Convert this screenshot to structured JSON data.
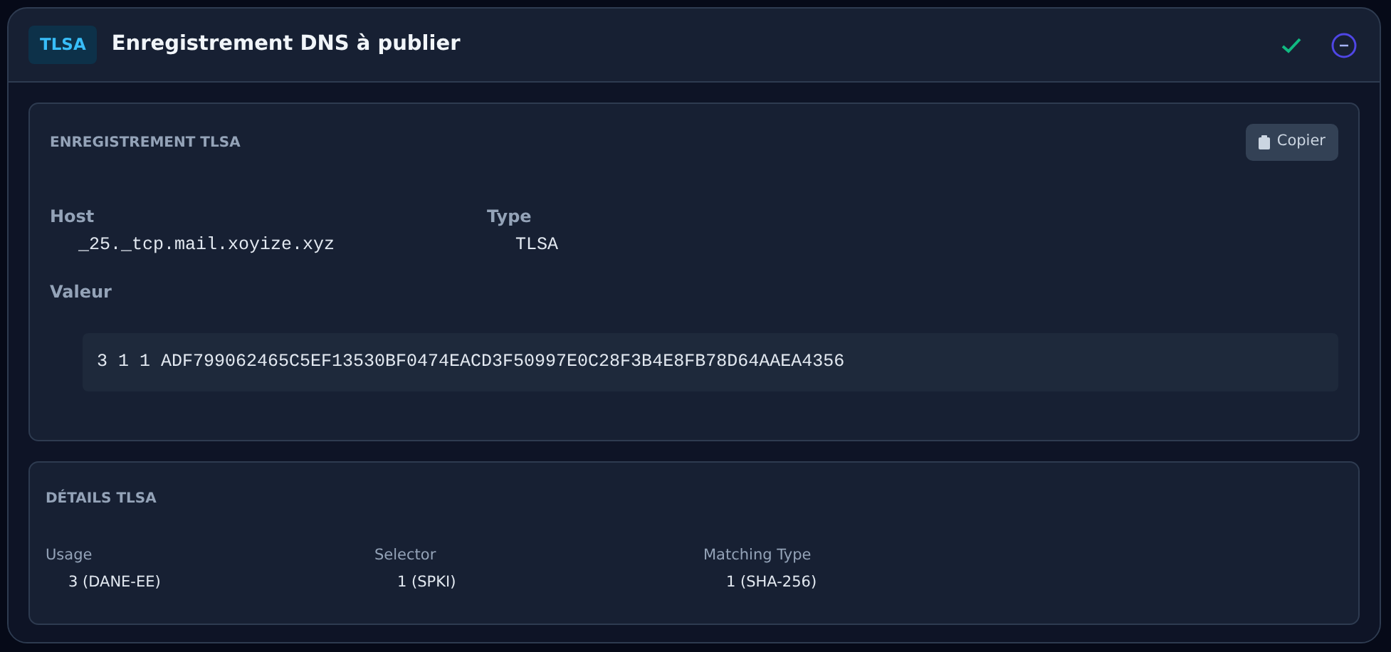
{
  "header": {
    "badge": "TLSA",
    "title": "Enregistrement DNS à publier"
  },
  "record": {
    "title": "ENREGISTREMENT TLSA",
    "copy_button": "Copier",
    "fields": [
      {
        "label": "Host",
        "value": "_25._tcp.mail.xoyize.xyz"
      },
      {
        "label": "Type",
        "value": "TLSA"
      }
    ],
    "value_label": "Valeur",
    "value": "3 1 1 ADF799062465C5EF13530BF0474EACD3F50997E0C28F3B4E8FB78D64AAEA4356"
  },
  "details": {
    "title": "DÉTAILS TLSA",
    "fields": [
      {
        "label": "Usage",
        "value": "3 (DANE-EE)"
      },
      {
        "label": "Selector",
        "value": "1 (SPKI)"
      },
      {
        "label": "Matching Type",
        "value": "1 (SHA-256)"
      }
    ]
  }
}
